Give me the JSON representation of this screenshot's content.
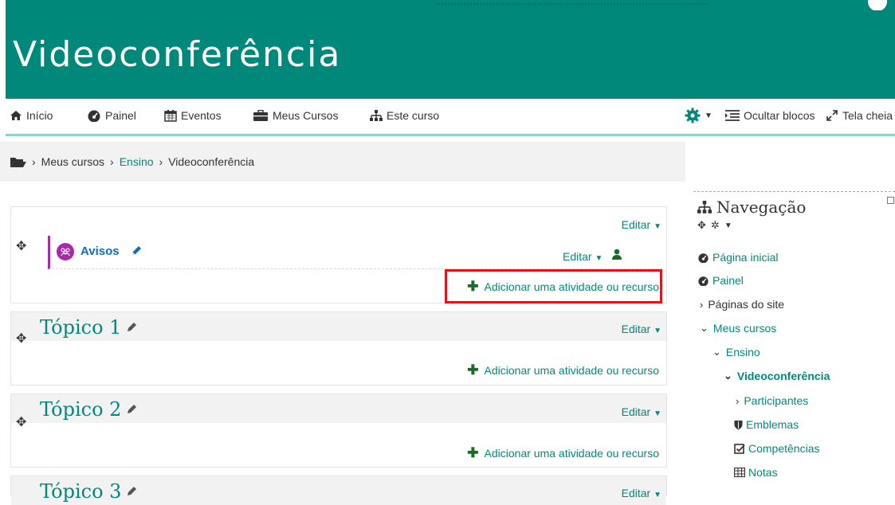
{
  "banner": {
    "title": "Videoconferência"
  },
  "navbar": {
    "items": [
      {
        "label": "Início",
        "icon": "home-icon"
      },
      {
        "label": "Painel",
        "icon": "dashboard-icon"
      },
      {
        "label": "Eventos",
        "icon": "calendar-icon"
      },
      {
        "label": "Meus Cursos",
        "icon": "briefcase-icon"
      },
      {
        "label": "Este curso",
        "icon": "sitemap-icon"
      }
    ],
    "settings_icon": "gear-icon",
    "hide_blocks_label": "Ocultar blocos",
    "fullscreen_label": "Tela cheia"
  },
  "breadcrumb": {
    "items": [
      "Meus cursos",
      "Ensino",
      "Videoconferência"
    ]
  },
  "sections": [
    {
      "title": "",
      "edit_label": "Editar",
      "add_label": "Adicionar uma atividade ou recurso",
      "activity": {
        "name": "Avisos",
        "edit_label": "Editar",
        "icon": "forum-icon"
      }
    },
    {
      "title": "Tópico 1",
      "edit_label": "Editar",
      "add_label": "Adicionar uma atividade ou recurso"
    },
    {
      "title": "Tópico 2",
      "edit_label": "Editar",
      "add_label": "Adicionar uma atividade ou recurso"
    },
    {
      "title": "Tópico 3",
      "edit_label": "Editar"
    }
  ],
  "nav_block": {
    "title": "Navegação",
    "items": [
      {
        "label": "Página inicial",
        "icon": "dashboard-icon"
      },
      {
        "label": "Painel",
        "icon": "dashboard-icon"
      },
      {
        "label": "Páginas do site",
        "icon": "chevron-right-icon"
      },
      {
        "label": "Meus cursos",
        "icon": "chevron-down-icon"
      },
      {
        "label": "Ensino",
        "icon": "chevron-down-icon"
      },
      {
        "label": "Videoconferência",
        "icon": "chevron-down-icon"
      },
      {
        "label": "Participantes",
        "icon": "chevron-right-icon"
      },
      {
        "label": "Emblemas",
        "icon": "shield-icon"
      },
      {
        "label": "Competências",
        "icon": "checkbox-icon"
      },
      {
        "label": "Notas",
        "icon": "table-icon"
      }
    ]
  },
  "colors": {
    "brand": "#00897b",
    "link": "#0f6cbf",
    "forum": "#a72aa8",
    "highlight": "#e0151b"
  }
}
